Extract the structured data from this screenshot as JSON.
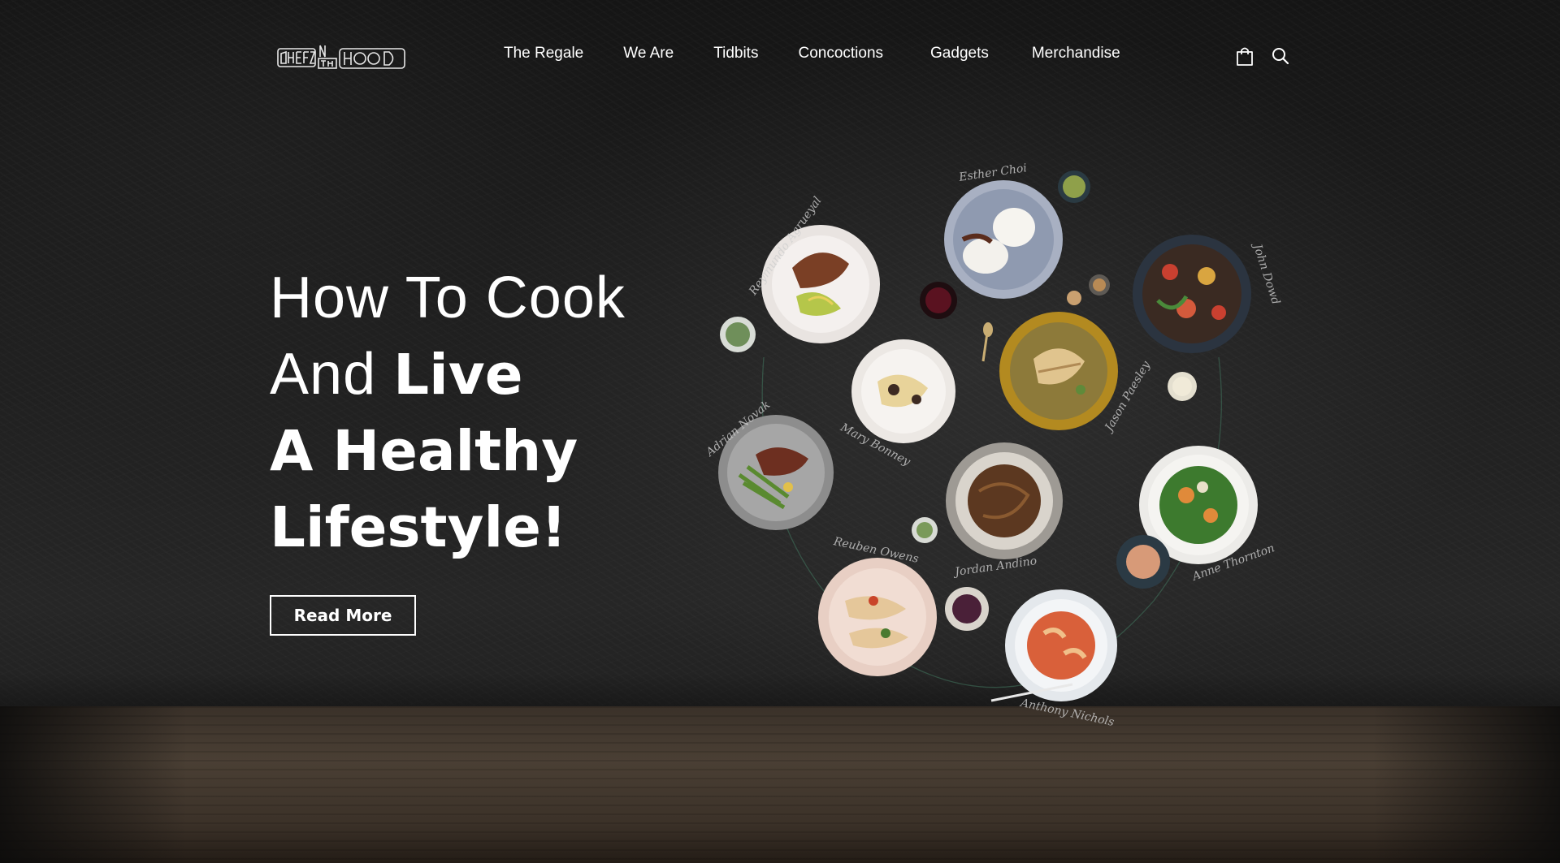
{
  "brand": {
    "logo_text": "CHEFZ IN THA HOOD"
  },
  "nav": {
    "items": [
      {
        "label": "The Regale"
      },
      {
        "label": "We Are"
      },
      {
        "label": "Tidbits"
      },
      {
        "label": "Concoctions"
      },
      {
        "label": "Gadgets"
      },
      {
        "label": "Merchandise"
      }
    ],
    "icons": [
      "shopping-bag-icon",
      "search-icon"
    ]
  },
  "hero": {
    "line1": "How To Cook",
    "line2_light": "And ",
    "line2_bold": "Live",
    "line3": "A Healthy",
    "line4": "Lifestyle!",
    "cta_label": "Read More"
  },
  "signatures": {
    "s1": "Esther Choi",
    "s2": "Reymundo Agrueyal",
    "s3": "John Dowd",
    "s4": "Adrian Novak",
    "s5": "Mary Bonney",
    "s6": "Jason Paesley",
    "s7": "Reuben Owens",
    "s8": "Jordan Andino",
    "s9": "Anne Thornton",
    "s10": "Anthony Nichols"
  },
  "colors": {
    "background": "#141414",
    "text": "#ffffff",
    "table_wood": "#4a3f34"
  }
}
